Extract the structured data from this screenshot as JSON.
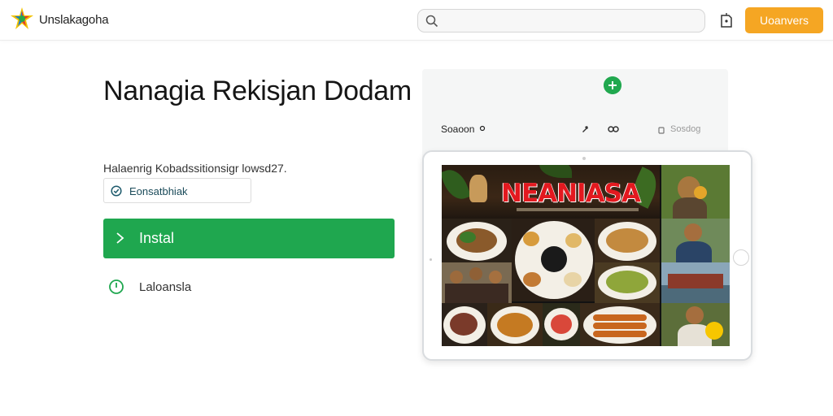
{
  "header": {
    "brand": "Unslakagoha",
    "search": {
      "value": "",
      "placeholder": ""
    },
    "signin_label": "Uoanvers"
  },
  "hero": {
    "title": "Nanagia Rekisjan Dodam",
    "subtitle": "Halaenrig Kobadssitionsigr lowsd27.",
    "badge_label": "Eonsatbhiak",
    "install_label": "Instal",
    "secondary_label": "Laloansla"
  },
  "preview": {
    "toolbar_label": "Soaoon",
    "toolbar_right": "Sosdog",
    "banner_title": "NEANIASA"
  },
  "colors": {
    "accent_green": "#1fa74f",
    "signin_orange": "#f5a623",
    "banner_red": "#e3191f"
  },
  "icons": [
    "logo-icon",
    "search-icon",
    "bell-icon",
    "check-icon",
    "play-icon",
    "clock-icon",
    "plus-icon",
    "pin-icon",
    "link-icon",
    "lock-icon"
  ]
}
